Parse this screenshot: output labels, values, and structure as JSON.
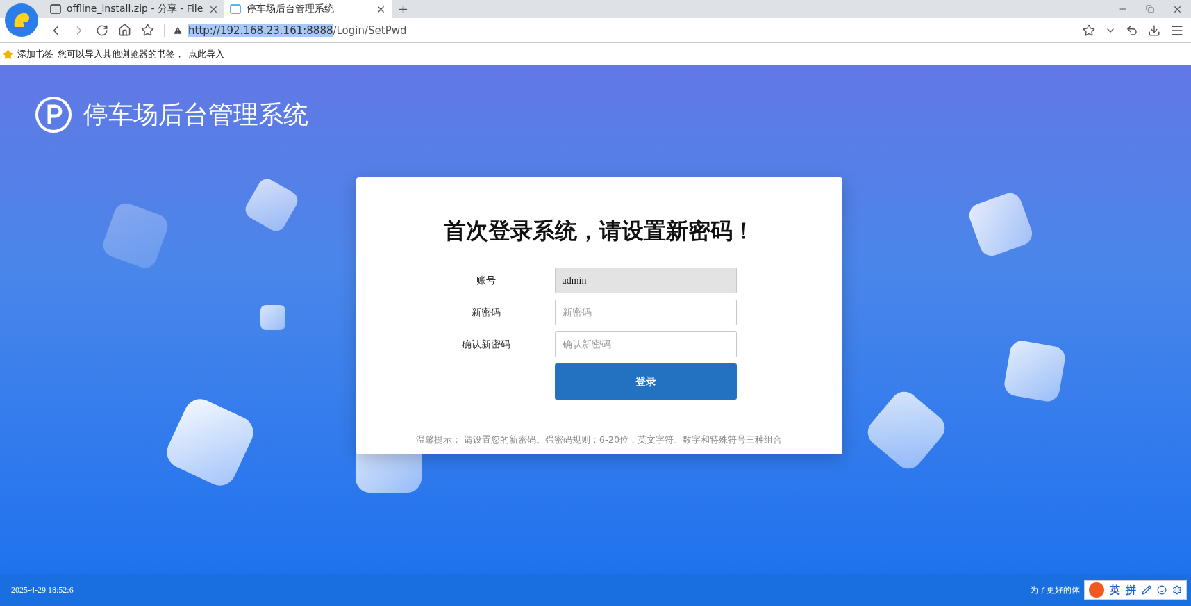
{
  "browser": {
    "tabs": [
      {
        "label": "offline_install.zip - 分享 - File",
        "selected": false
      },
      {
        "label": "停车场后台管理系统",
        "selected": true
      }
    ],
    "address": {
      "host": "http://192.168.23.161:8888",
      "path": "/Login/SetPwd"
    },
    "bookmarks_bar": {
      "add": "添加书签",
      "hint": "您可以导入其他浏览器的书签，",
      "link": "点此导入"
    }
  },
  "page": {
    "brand": "停车场后台管理系统",
    "heading": "首次登录系统，请设置新密码！",
    "fields": [
      {
        "label": "账号",
        "value": "admin",
        "disabled": true
      },
      {
        "label": "新密码",
        "placeholder": "新密码",
        "disabled": false
      },
      {
        "label": "确认新密码",
        "placeholder": "确认新密码",
        "disabled": false
      }
    ],
    "submit": "登录",
    "tip": "温馨提示： 请设置您的新密码。强密码规则：6-20位，英文字符、数字和特殊符号三种组合"
  },
  "footer": {
    "time": "2025-4-29 18:52:6",
    "notice": "为了更好的体"
  },
  "ime": {
    "mode": "英",
    "input": "拼"
  }
}
